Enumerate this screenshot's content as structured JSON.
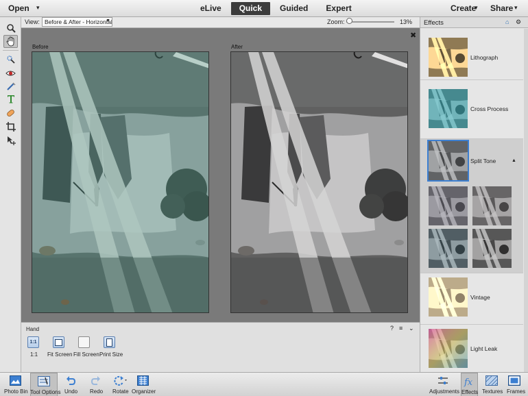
{
  "topbar": {
    "open_label": "Open",
    "modes": [
      {
        "label": "eLive",
        "active": false
      },
      {
        "label": "Quick",
        "active": true
      },
      {
        "label": "Guided",
        "active": false
      },
      {
        "label": "Expert",
        "active": false
      }
    ],
    "create_label": "Create",
    "share_label": "Share"
  },
  "options_bar": {
    "view_label": "View:",
    "view_value": "Before & After - Horizontal",
    "zoom_label": "Zoom:",
    "zoom_value": "13%",
    "zoom_fraction": 0.13
  },
  "canvas": {
    "before_label": "Before",
    "after_label": "After"
  },
  "tool_options": {
    "title": "Hand",
    "buttons": [
      {
        "label": "1:1"
      },
      {
        "label": "Fit Screen"
      },
      {
        "label": "Fill Screen"
      },
      {
        "label": "Print Size"
      }
    ],
    "one_to_one_badge": "1:1"
  },
  "effects": {
    "title": "Effects",
    "items": [
      {
        "label": "Lithograph"
      },
      {
        "label": "Cross Process"
      },
      {
        "label": "Split Tone",
        "selected": true,
        "expanded": true
      },
      {
        "label": "Vintage"
      },
      {
        "label": "Light Leak"
      }
    ]
  },
  "bottombar": {
    "items": [
      {
        "label": "Photo Bin",
        "icon": "photo-bin-icon"
      },
      {
        "label": "Tool Options",
        "icon": "tool-options-icon",
        "active": true
      },
      {
        "label": "Undo",
        "icon": "undo-icon"
      },
      {
        "label": "Redo",
        "icon": "redo-icon"
      },
      {
        "label": "Rotate",
        "icon": "rotate-icon"
      },
      {
        "label": "Organizer",
        "icon": "organizer-icon"
      },
      {
        "label": "Adjustments",
        "icon": "adjustments-icon"
      },
      {
        "label": "Effects",
        "icon": "fx-icon",
        "active": true
      },
      {
        "label": "Textures",
        "icon": "textures-icon"
      },
      {
        "label": "Frames",
        "icon": "frames-icon"
      }
    ]
  },
  "colors": {
    "accent": "#3c7fd1",
    "active_mode_bg": "#3c3c3c",
    "canvas_bg": "#7a7a7a"
  }
}
